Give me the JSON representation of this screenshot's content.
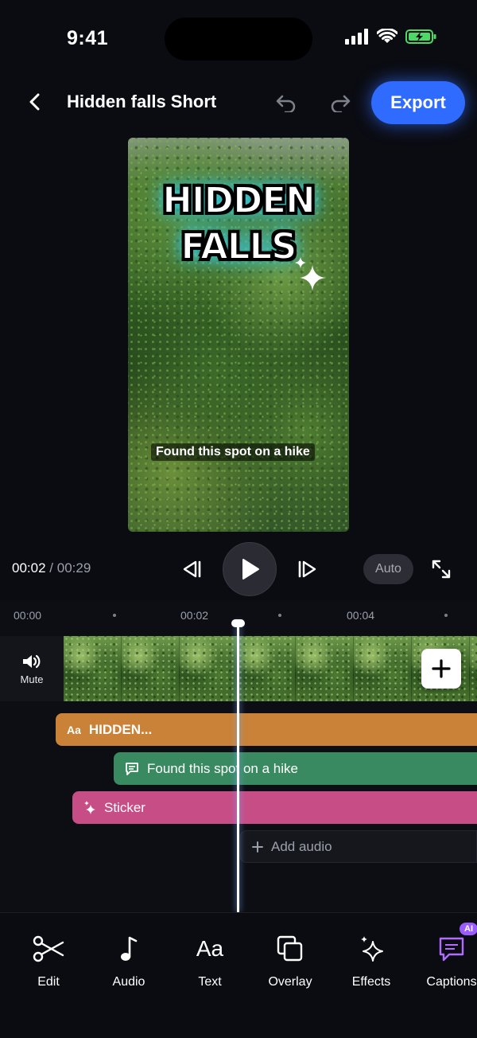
{
  "status": {
    "time": "9:41"
  },
  "header": {
    "title": "Hidden falls Short",
    "export_label": "Export"
  },
  "preview": {
    "title_line1": "HIDDEN",
    "title_line2": "FALLS",
    "caption": "Found this spot on a hike"
  },
  "playback": {
    "current": "00:02",
    "separator": "/",
    "total": "00:29",
    "auto_label": "Auto"
  },
  "timeline": {
    "ruler": [
      "00:00",
      "00:02",
      "00:04"
    ],
    "mute_label": "Mute",
    "tracks": {
      "text_icon": "Aa",
      "text_label": "HIDDEN...",
      "caption_label": "Found this spot on a hike",
      "sticker_label": "Sticker",
      "add_audio_label": "Add audio"
    }
  },
  "toolbar": {
    "items": [
      {
        "label": "Edit",
        "icon": "scissors-icon"
      },
      {
        "label": "Audio",
        "icon": "music-note-icon"
      },
      {
        "label": "Text",
        "icon": "text-aa-icon"
      },
      {
        "label": "Overlay",
        "icon": "overlay-icon"
      },
      {
        "label": "Effects",
        "icon": "sparkles-icon"
      },
      {
        "label": "Captions",
        "icon": "captions-icon"
      }
    ],
    "text_icon_glyph": "Aa",
    "ai_badge": "AI"
  },
  "colors": {
    "accent": "#2f6bff",
    "text_track": "#c98237",
    "caption_track": "#3a8a61",
    "sticker_track": "#c74d86",
    "battery": "#4cd964"
  }
}
